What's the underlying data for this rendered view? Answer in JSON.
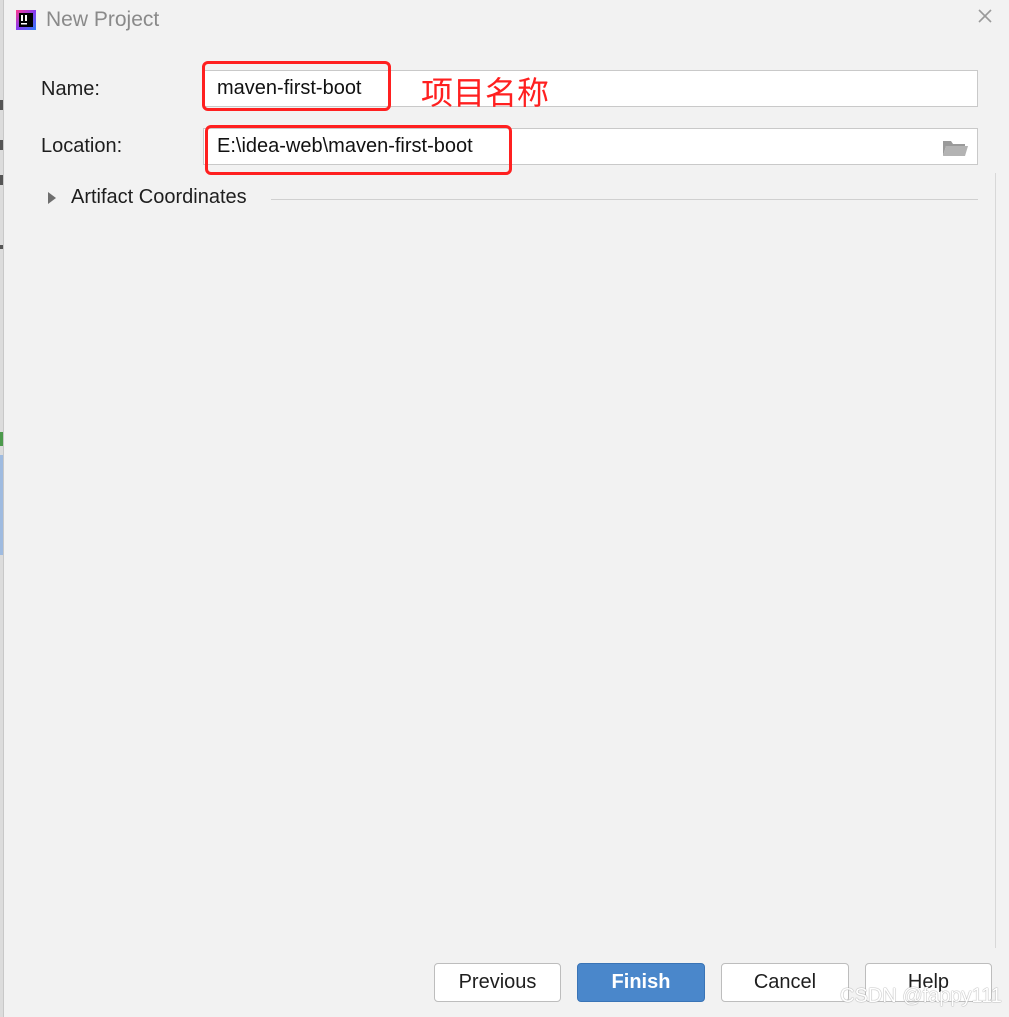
{
  "dialog": {
    "title": "New Project"
  },
  "form": {
    "name_label": "Name:",
    "name_value": "maven-first-boot",
    "location_label": "Location:",
    "location_value": "E:\\idea-web\\maven-first-boot"
  },
  "annotation": {
    "name_note": "项目名称",
    "highlight_color": "#ff2020"
  },
  "sections": {
    "artifact_coordinates": "Artifact Coordinates"
  },
  "buttons": {
    "previous": "Previous",
    "finish": "Finish",
    "cancel": "Cancel",
    "help": "Help"
  },
  "watermark": "CSDN @fappy111",
  "colors": {
    "primary_button": "#4a87cb",
    "background": "#f2f2f2"
  },
  "icons": {
    "app": "intellij-idea-icon",
    "close": "close-icon",
    "folder": "folder-icon",
    "expand": "triangle-right-icon"
  }
}
